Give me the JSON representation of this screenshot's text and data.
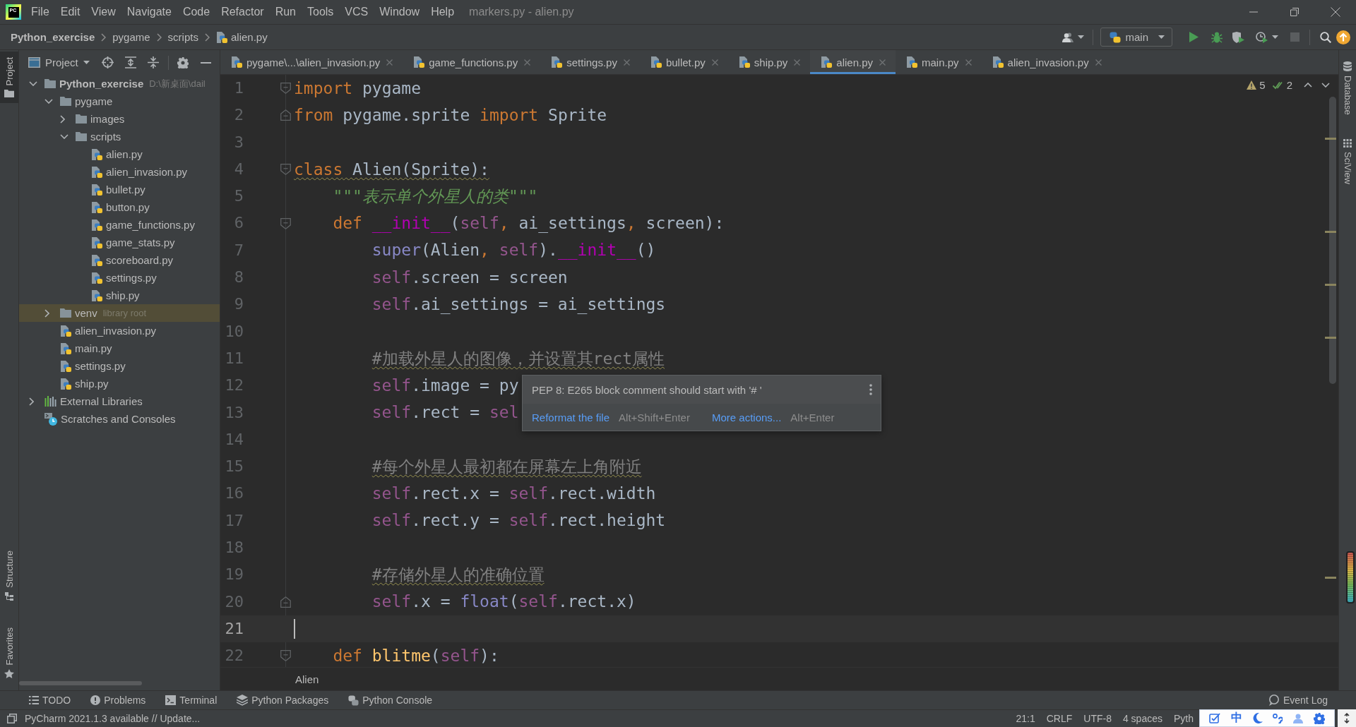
{
  "window": {
    "logo": "PC",
    "title": "markers.py - alien.py"
  },
  "menu": [
    "File",
    "Edit",
    "View",
    "Navigate",
    "Code",
    "Refactor",
    "Run",
    "Tools",
    "VCS",
    "Window",
    "Help"
  ],
  "navbar": {
    "breadcrumbs": [
      {
        "label": "Python_exercise",
        "kind": "project"
      },
      {
        "label": "pygame",
        "kind": "folder"
      },
      {
        "label": "scripts",
        "kind": "folder"
      },
      {
        "label": "alien.py",
        "kind": "file"
      }
    ],
    "run_config": "main",
    "stop": {
      "disabled": true
    }
  },
  "left_stripe": {
    "top": [
      {
        "label": "Project",
        "kind": "project",
        "selected": true
      }
    ],
    "bottom": [
      {
        "label": "Structure",
        "kind": "structure",
        "selected": false
      },
      {
        "label": "Favorites",
        "kind": "favorites",
        "selected": false
      }
    ]
  },
  "right_stripe": {
    "top": [
      {
        "label": "Database",
        "kind": "database",
        "selected": false
      },
      {
        "label": "SciView",
        "kind": "sciview",
        "selected": false
      }
    ]
  },
  "project_panel": {
    "title": "Project",
    "tree": [
      {
        "label": "Python_exercise",
        "kind": "project",
        "expanded": true,
        "highlighted": false,
        "hint": "D:\\新桌面\\dail",
        "children": [
          {
            "label": "pygame",
            "kind": "folder",
            "expanded": true,
            "highlighted": false,
            "children": [
              {
                "label": "images",
                "kind": "folder",
                "expanded": false,
                "highlighted": false
              },
              {
                "label": "scripts",
                "kind": "folder",
                "expanded": true,
                "highlighted": false,
                "children": [
                  {
                    "label": "alien.py",
                    "kind": "python-file",
                    "highlighted": false
                  },
                  {
                    "label": "alien_invasion.py",
                    "kind": "python-file",
                    "highlighted": false
                  },
                  {
                    "label": "bullet.py",
                    "kind": "python-file",
                    "highlighted": false
                  },
                  {
                    "label": "button.py",
                    "kind": "python-file",
                    "highlighted": false
                  },
                  {
                    "label": "game_functions.py",
                    "kind": "python-file",
                    "highlighted": false
                  },
                  {
                    "label": "game_stats.py",
                    "kind": "python-file",
                    "highlighted": false
                  },
                  {
                    "label": "scoreboard.py",
                    "kind": "python-file",
                    "highlighted": false
                  },
                  {
                    "label": "settings.py",
                    "kind": "python-file",
                    "highlighted": false
                  },
                  {
                    "label": "ship.py",
                    "kind": "python-file",
                    "highlighted": false
                  }
                ]
              }
            ]
          },
          {
            "label": "venv",
            "kind": "folder",
            "expanded": false,
            "highlighted": true,
            "hint": "library root"
          },
          {
            "label": "alien_invasion.py",
            "kind": "python-file",
            "highlighted": false
          },
          {
            "label": "main.py",
            "kind": "python-file",
            "highlighted": false
          },
          {
            "label": "settings.py",
            "kind": "python-file",
            "highlighted": false
          },
          {
            "label": "ship.py",
            "kind": "python-file",
            "highlighted": false
          }
        ]
      },
      {
        "label": "External Libraries",
        "kind": "libraries",
        "expanded": false,
        "highlighted": false
      },
      {
        "label": "Scratches and Consoles",
        "kind": "scratches",
        "highlighted": false
      }
    ]
  },
  "editor": {
    "tabs": [
      {
        "label": "pygame\\...\\alien_invasion.py",
        "selected": false
      },
      {
        "label": "game_functions.py",
        "selected": false
      },
      {
        "label": "settings.py",
        "selected": false
      },
      {
        "label": "bullet.py",
        "selected": false
      },
      {
        "label": "ship.py",
        "selected": false
      },
      {
        "label": "alien.py",
        "selected": true
      },
      {
        "label": "main.py",
        "selected": false
      },
      {
        "label": "alien_invasion.py",
        "selected": false
      }
    ],
    "inspections": {
      "warning_count": "5",
      "check_count": "2"
    },
    "lines": [
      {
        "number": "1",
        "kind": "foldstart",
        "current": false,
        "warning": false,
        "tokens": [
          {
            "kind": "keyword",
            "text": "import"
          },
          {
            "kind": "plain",
            "text": " pygame"
          }
        ]
      },
      {
        "number": "2",
        "kind": "foldend",
        "current": false,
        "warning": false,
        "tokens": [
          {
            "kind": "keyword",
            "text": "from"
          },
          {
            "kind": "plain",
            "text": " pygame.sprite "
          },
          {
            "kind": "keyword",
            "text": "import"
          },
          {
            "kind": "plain",
            "text": " Sprite"
          }
        ]
      },
      {
        "number": "3",
        "kind": "blank",
        "current": false
      },
      {
        "number": "4",
        "kind": "foldstart",
        "current": false,
        "warning": true,
        "tokens": [
          {
            "kind": "keyword",
            "text": "class"
          },
          {
            "kind": "plain",
            "text": " Alien(Sprite):"
          }
        ],
        "children": [
          {
            "number": "5",
            "kind": "code",
            "current": false,
            "warning": false,
            "tokens": [
              {
                "kind": "docstring",
                "text": "\"\"\"表示单个外星人的类\"\"\""
              }
            ]
          },
          {
            "number": "6",
            "kind": "foldstart",
            "current": false,
            "warning": false,
            "tokens": [
              {
                "kind": "keyword",
                "text": "def "
              },
              {
                "kind": "magic",
                "text": "__init__"
              },
              {
                "kind": "plain",
                "text": "("
              },
              {
                "kind": "self",
                "text": "self"
              },
              {
                "kind": "comma",
                "text": ", "
              },
              {
                "kind": "plain",
                "text": "ai_settings"
              },
              {
                "kind": "comma",
                "text": ", "
              },
              {
                "kind": "plain",
                "text": "screen):"
              }
            ],
            "children": [
              {
                "number": "7",
                "kind": "code",
                "current": false,
                "warning": false,
                "tokens": [
                  {
                    "kind": "builtin",
                    "text": "super"
                  },
                  {
                    "kind": "plain",
                    "text": "(Alien"
                  },
                  {
                    "kind": "comma",
                    "text": ", "
                  },
                  {
                    "kind": "self",
                    "text": "self"
                  },
                  {
                    "kind": "plain",
                    "text": ")."
                  },
                  {
                    "kind": "magic",
                    "text": "__init__"
                  },
                  {
                    "kind": "plain",
                    "text": "()"
                  }
                ]
              },
              {
                "number": "8",
                "kind": "code",
                "current": false,
                "warning": false,
                "tokens": [
                  {
                    "kind": "self",
                    "text": "self"
                  },
                  {
                    "kind": "plain",
                    "text": ".screen = screen"
                  }
                ]
              },
              {
                "number": "9",
                "kind": "code",
                "current": false,
                "warning": false,
                "tokens": [
                  {
                    "kind": "self",
                    "text": "self"
                  },
                  {
                    "kind": "plain",
                    "text": ".ai_settings = ai_settings"
                  }
                ]
              },
              {
                "number": "10",
                "kind": "blank",
                "current": false
              },
              {
                "number": "11",
                "kind": "code",
                "current": false,
                "warning": true,
                "tokens": [
                  {
                    "kind": "comment",
                    "text": "#加载外星人的图像，并设置其rect属性"
                  }
                ]
              },
              {
                "number": "12",
                "kind": "code",
                "current": false,
                "warning": false,
                "tokens": [
                  {
                    "kind": "self",
                    "text": "self"
                  },
                  {
                    "kind": "plain",
                    "text": ".image = py"
                  }
                ]
              },
              {
                "number": "13",
                "kind": "code",
                "current": false,
                "warning": false,
                "tokens": [
                  {
                    "kind": "self",
                    "text": "self"
                  },
                  {
                    "kind": "plain",
                    "text": ".rect = "
                  },
                  {
                    "kind": "self",
                    "text": "sel"
                  }
                ]
              },
              {
                "number": "14",
                "kind": "blank",
                "current": false
              },
              {
                "number": "15",
                "kind": "code",
                "current": false,
                "warning": true,
                "tokens": [
                  {
                    "kind": "comment",
                    "text": "#每个外星人最初都在屏幕左上角附近"
                  }
                ]
              },
              {
                "number": "16",
                "kind": "code",
                "current": false,
                "warning": false,
                "tokens": [
                  {
                    "kind": "self",
                    "text": "self"
                  },
                  {
                    "kind": "plain",
                    "text": ".rect.x = "
                  },
                  {
                    "kind": "self",
                    "text": "self"
                  },
                  {
                    "kind": "plain",
                    "text": ".rect.width"
                  }
                ]
              },
              {
                "number": "17",
                "kind": "code",
                "current": false,
                "warning": false,
                "tokens": [
                  {
                    "kind": "self",
                    "text": "self"
                  },
                  {
                    "kind": "plain",
                    "text": ".rect.y = "
                  },
                  {
                    "kind": "self",
                    "text": "self"
                  },
                  {
                    "kind": "plain",
                    "text": ".rect.height"
                  }
                ]
              },
              {
                "number": "18",
                "kind": "blank",
                "current": false
              },
              {
                "number": "19",
                "kind": "code",
                "current": false,
                "warning": true,
                "tokens": [
                  {
                    "kind": "comment",
                    "text": "#存储外星人的准确位置"
                  }
                ]
              },
              {
                "number": "20",
                "kind": "foldend",
                "current": false,
                "warning": false,
                "tokens": [
                  {
                    "kind": "self",
                    "text": "self"
                  },
                  {
                    "kind": "plain",
                    "text": ".x = "
                  },
                  {
                    "kind": "builtin",
                    "text": "float"
                  },
                  {
                    "kind": "plain",
                    "text": "("
                  },
                  {
                    "kind": "self",
                    "text": "self"
                  },
                  {
                    "kind": "plain",
                    "text": ".rect.x)"
                  }
                ]
              }
            ]
          },
          {
            "number": "21",
            "kind": "blank",
            "current": true
          },
          {
            "number": "22",
            "kind": "foldstart",
            "current": false,
            "warning": false,
            "tokens": [
              {
                "kind": "keyword",
                "text": "def "
              },
              {
                "kind": "function",
                "text": "blitme"
              },
              {
                "kind": "plain",
                "text": "("
              },
              {
                "kind": "self",
                "text": "self"
              },
              {
                "kind": "plain",
                "text": "):"
              }
            ]
          }
        ]
      }
    ],
    "popup": {
      "message": "PEP 8: E265 block comment should start with '# '",
      "actions": [
        {
          "label": "Reformat the file",
          "shortcut": "Alt+Shift+Enter"
        },
        {
          "label": "More actions...",
          "shortcut": "Alt+Enter"
        }
      ]
    },
    "breadcrumb": "Alien"
  },
  "tool_windows": [
    {
      "label": "TODO",
      "kind": "todo"
    },
    {
      "label": "Problems",
      "kind": "problems"
    },
    {
      "label": "Terminal",
      "kind": "terminal"
    },
    {
      "label": "Python Packages",
      "kind": "packages"
    },
    {
      "label": "Python Console",
      "kind": "console"
    }
  ],
  "event_log": "Event Log",
  "status_bar": {
    "message": "PyCharm 2021.1.3 available // Update...",
    "items": [
      "21:1",
      "CRLF",
      "UTF-8",
      "4 spaces",
      "Pyth"
    ]
  },
  "ime_toolbar": {
    "mode": "中"
  }
}
